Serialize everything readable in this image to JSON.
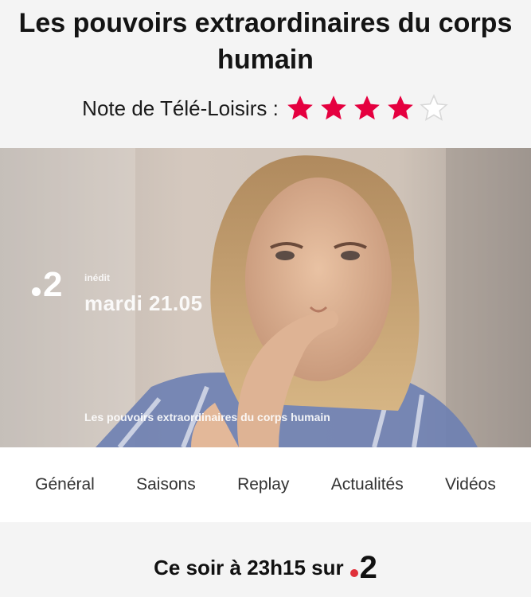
{
  "header": {
    "title": "Les pouvoirs extraordinaires du corps humain",
    "rating_label": "Note de Télé-Loisirs :",
    "rating": 4,
    "rating_max": 5
  },
  "hero": {
    "channel": "2",
    "tag": "inédit",
    "date": "mardi 21.05",
    "caption": "Les pouvoirs extraordinaires du corps humain"
  },
  "tabs": [
    "Général",
    "Saisons",
    "Replay",
    "Actualités",
    "Vidéos"
  ],
  "broadcast": {
    "text": "Ce soir à 23h15 sur",
    "channel": "2"
  },
  "colors": {
    "star_filled": "#e5003f",
    "channel_dot": "#e0303a"
  },
  "icons": {
    "star": "star-icon",
    "channel_logo": "france2-logo"
  }
}
